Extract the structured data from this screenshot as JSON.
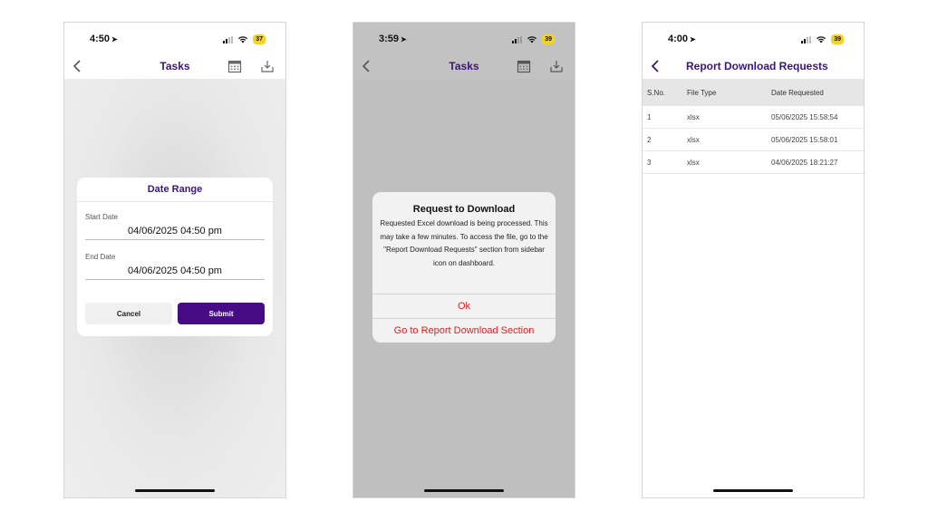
{
  "phone1": {
    "status": {
      "time": "4:50",
      "battery": "37"
    },
    "nav": {
      "title": "Tasks"
    },
    "dialog": {
      "title": "Date Range",
      "start_label": "Start Date",
      "start_value": "04/06/2025 04:50 pm",
      "end_label": "End Date",
      "end_value": "04/06/2025 04:50 pm",
      "cancel": "Cancel",
      "submit": "Submit"
    }
  },
  "phone2": {
    "status": {
      "time": "3:59",
      "battery": "39"
    },
    "nav": {
      "title": "Tasks"
    },
    "alert": {
      "title": "Request to Download",
      "message": "Requested Excel download is being processed. This may take a few minutes. To access the file, go to the \"Report Download Requests\" section from sidebar icon on dashboard.",
      "ok": "Ok",
      "goto": "Go to Report Download Section"
    }
  },
  "phone3": {
    "status": {
      "time": "4:00",
      "battery": "39"
    },
    "nav": {
      "title": "Report Download Requests"
    },
    "table": {
      "headers": [
        "S.No.",
        "File Type",
        "Date Requested"
      ],
      "rows": [
        [
          "1",
          "xlsx",
          "05/06/2025 15:58:54"
        ],
        [
          "2",
          "xlsx",
          "05/06/2025 15:58:01"
        ],
        [
          "3",
          "xlsx",
          "04/06/2025 18:21:27"
        ]
      ]
    }
  },
  "colors": {
    "accent": "#3d1380",
    "submit_bg": "#470b86",
    "destructive": "#e02020",
    "battery": "#f4d21f"
  },
  "icons": [
    "location-arrow-icon",
    "cellular-signal-icon",
    "wifi-icon",
    "battery-icon",
    "back-chevron-icon",
    "calendar-icon",
    "download-icon"
  ]
}
